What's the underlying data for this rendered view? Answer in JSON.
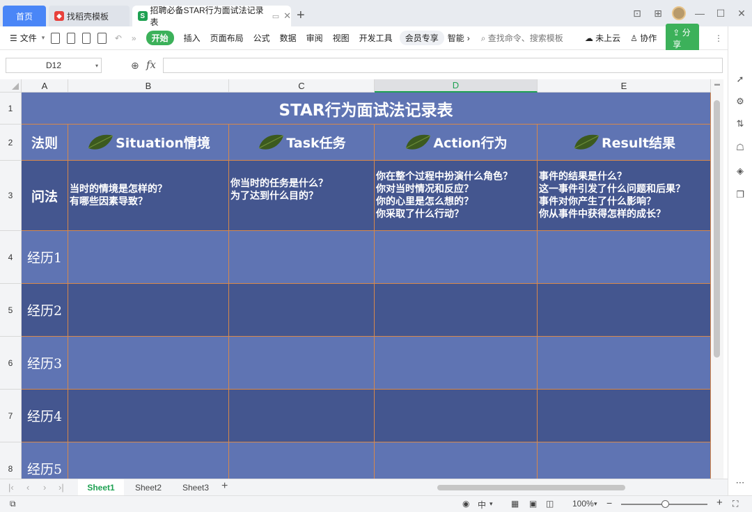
{
  "tabs": {
    "home": "首页",
    "template": "找稻壳模板",
    "document": "招聘必备STAR行为面试法记录表",
    "new_tab": "+"
  },
  "ribbon": {
    "file": "文件",
    "start": "开始",
    "insert": "插入",
    "page_layout": "页面布局",
    "formula": "公式",
    "data": "数据",
    "review": "审阅",
    "view": "视图",
    "dev_tools": "开发工具",
    "member": "会员专享",
    "smart": "智能",
    "search": "查找命令、搜索模板",
    "cloud": "未上云",
    "collab": "协作",
    "share": "分享"
  },
  "formula_bar": {
    "cell_ref": "D12",
    "fx": "fx",
    "value": ""
  },
  "columns": [
    "A",
    "B",
    "C",
    "D",
    "E"
  ],
  "active_column": "D",
  "rows": [
    "1",
    "2",
    "3",
    "4",
    "5",
    "6",
    "7",
    "8"
  ],
  "table": {
    "title": "STAR行为面试法记录表",
    "rule_label": "法则",
    "headers": [
      "Situation情境",
      "Task任务",
      "Action行为",
      "Result结果"
    ],
    "question_label": "问法",
    "questions": {
      "situation": [
        "当时的情境是怎样的？",
        "有哪些因素导致？"
      ],
      "task": [
        "你当时的任务是什么？",
        "为了达到什么目的？"
      ],
      "action": [
        "你在整个过程中扮演什么角色？",
        "你对当时情况和反应？",
        "你的心里是怎么想的？",
        "你采取了什么行动？"
      ],
      "result": [
        "事件的结果是什么？",
        "这一事件引发了什么问题和后果？",
        "事件对你产生了什么影响？",
        "你从事件中获得怎样的成长？"
      ]
    },
    "experiences": [
      "经历1",
      "经历2",
      "经历3",
      "经历4",
      "经历5"
    ],
    "colors": {
      "band_light": "#5f74b3",
      "band_dark": "#44568f",
      "grid": "#d8884a"
    }
  },
  "sheet_tabs": [
    "Sheet1",
    "Sheet2",
    "Sheet3"
  ],
  "active_sheet": "Sheet1",
  "status": {
    "input_mode": "中",
    "zoom": "100%",
    "minus": "−",
    "plus": "+"
  }
}
